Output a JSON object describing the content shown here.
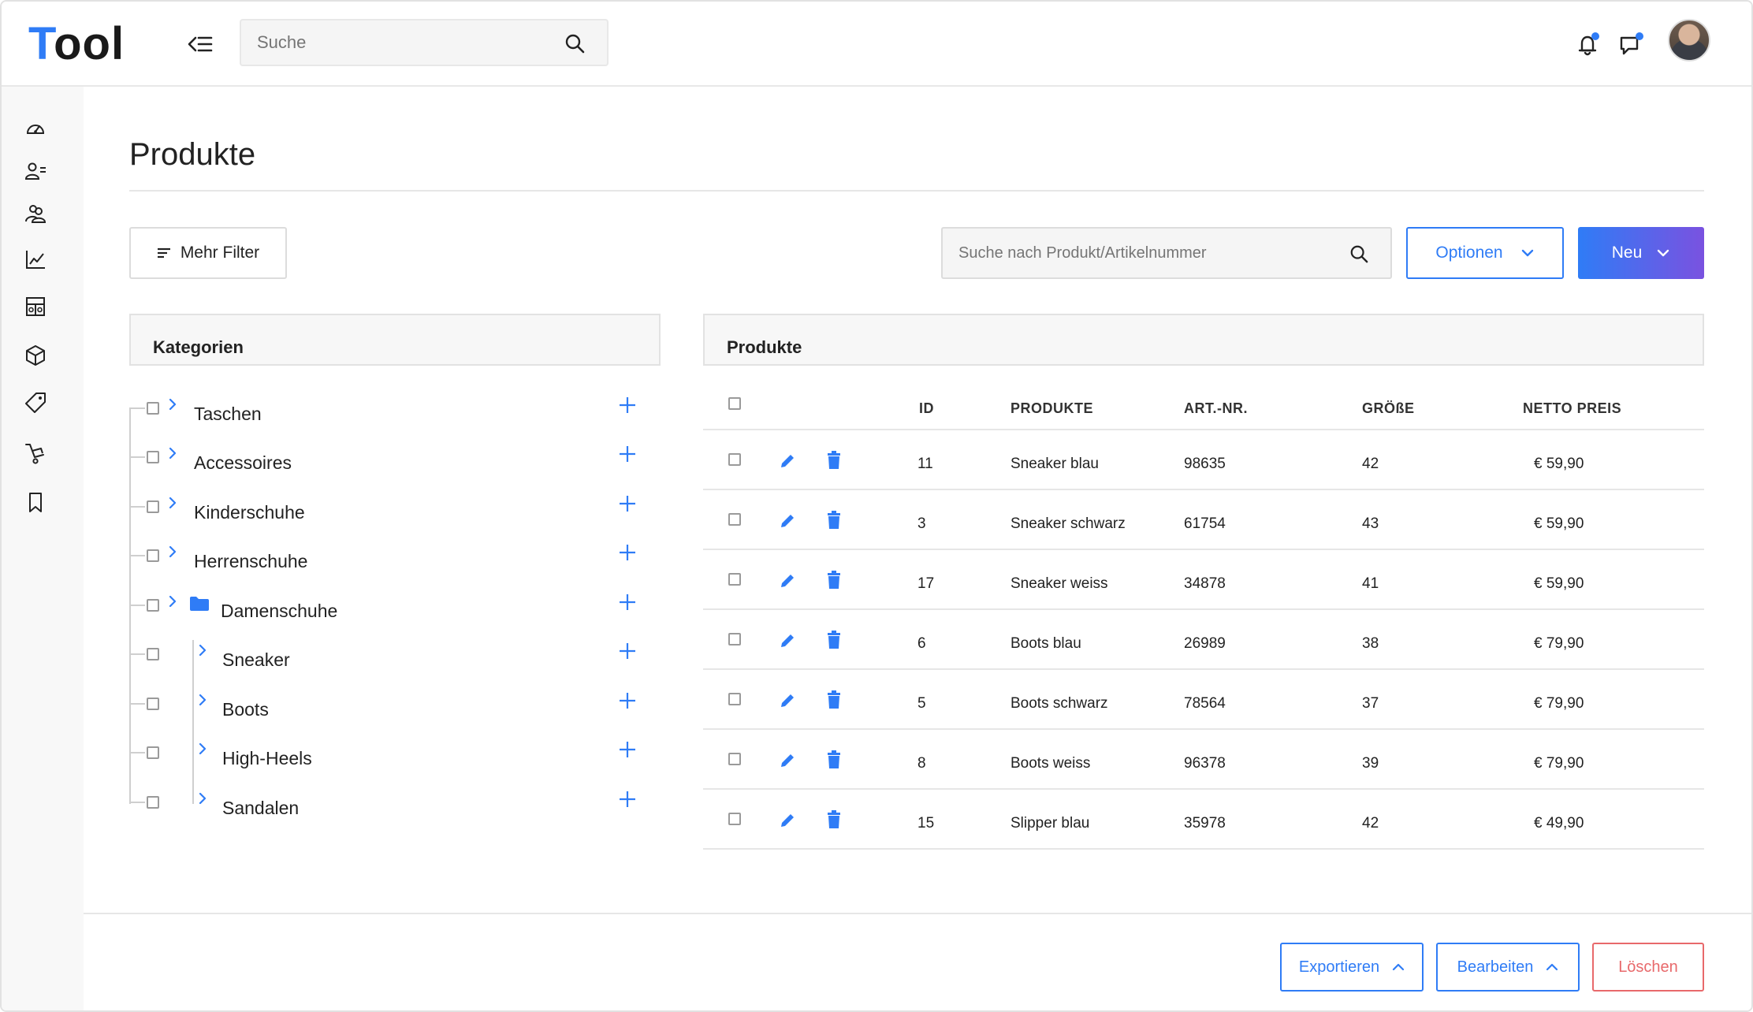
{
  "app": {
    "logo_first": "T",
    "logo_rest": "ool"
  },
  "header": {
    "search_placeholder": "Suche"
  },
  "page": {
    "title": "Produkte"
  },
  "toolbar": {
    "filter_label": "Mehr Filter",
    "product_search_placeholder": "Suche nach Produkt/Artikelnummer",
    "options_label": "Optionen",
    "new_label": "Neu"
  },
  "categories": {
    "heading": "Kategorien",
    "items": [
      {
        "label": "Taschen"
      },
      {
        "label": "Accessoires"
      },
      {
        "label": "Kinderschuhe"
      },
      {
        "label": "Herrenschuhe"
      },
      {
        "label": "Damenschuhe"
      },
      {
        "label": "Sneaker"
      },
      {
        "label": "Boots"
      },
      {
        "label": "High-Heels"
      },
      {
        "label": "Sandalen"
      }
    ]
  },
  "products": {
    "heading": "Produkte",
    "columns": {
      "id": "ID",
      "product": "PRODUKTE",
      "art_nr": "ART.-NR.",
      "size": "GRÖßE",
      "price": "NETTO PREIS"
    },
    "rows": [
      {
        "id": "11",
        "name": "Sneaker blau",
        "art_nr": "98635",
        "size": "42",
        "price": "€ 59,90"
      },
      {
        "id": "3",
        "name": "Sneaker schwarz",
        "art_nr": "61754",
        "size": "43",
        "price": "€ 59,90"
      },
      {
        "id": "17",
        "name": "Sneaker weiss",
        "art_nr": "34878",
        "size": "41",
        "price": "€ 59,90"
      },
      {
        "id": "6",
        "name": "Boots blau",
        "art_nr": "26989",
        "size": "38",
        "price": "€ 79,90"
      },
      {
        "id": "5",
        "name": "Boots schwarz",
        "art_nr": "78564",
        "size": "37",
        "price": "€ 79,90"
      },
      {
        "id": "8",
        "name": "Boots weiss",
        "art_nr": "96378",
        "size": "39",
        "price": "€ 79,90"
      },
      {
        "id": "15",
        "name": "Slipper blau",
        "art_nr": "35978",
        "size": "42",
        "price": "€ 49,90"
      }
    ]
  },
  "footer": {
    "export_label": "Exportieren",
    "edit_label": "Bearbeiten",
    "delete_label": "Löschen"
  },
  "colors": {
    "accent": "#2f7cf6",
    "accent_gradient_end": "#7a52e0",
    "danger": "#e8696b"
  },
  "icons": [
    "collapse-menu-icon",
    "search-icon",
    "bell-icon",
    "chat-icon",
    "dashboard-icon",
    "users-icon",
    "groups-icon",
    "chart-icon",
    "table-icon",
    "box-icon",
    "tag-icon",
    "cart-icon",
    "bookmark-icon",
    "filter-lines-icon",
    "chevron-down-icon",
    "chevron-right-icon",
    "chevron-up-icon",
    "plus-icon",
    "folder-icon",
    "edit-pencil-icon",
    "trash-icon"
  ]
}
